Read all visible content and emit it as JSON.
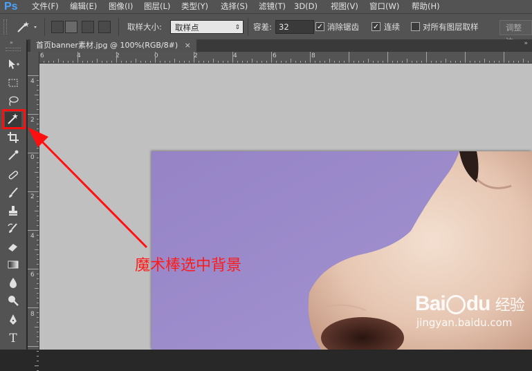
{
  "app": {
    "logo": "Ps"
  },
  "menu": [
    "文件(F)",
    "编辑(E)",
    "图像(I)",
    "图层(L)",
    "类型(Y)",
    "选择(S)",
    "滤镜(T)",
    "3D(D)",
    "视图(V)",
    "窗口(W)",
    "帮助(H)"
  ],
  "options": {
    "sample_size_label": "取样大小:",
    "sample_size_value": "取样点",
    "tolerance_label": "容差:",
    "tolerance_value": "32",
    "anti_alias_label": "消除锯齿",
    "anti_alias_checked": true,
    "contiguous_label": "连续",
    "contiguous_checked": true,
    "all_layers_label": "对所有图层取样",
    "all_layers_checked": false,
    "refine_edge_label": "调整边"
  },
  "document": {
    "tab_title": "首页banner素材.jpg @ 100%(RGB/8#)",
    "close_glyph": "×"
  },
  "rulers": {
    "top_labels": [
      "6",
      "4",
      "2",
      "0",
      "2",
      "4",
      "6",
      "8"
    ],
    "left_labels": [
      "4",
      "2",
      "0",
      "2",
      "4",
      "6",
      "8"
    ]
  },
  "annotation": {
    "text": "魔术棒选中背景",
    "color": "#ff1a1a"
  },
  "watermark": {
    "brand": "Bai",
    "brand_suffix": "du",
    "product": "经验",
    "url": "jingyan.baidu.com"
  },
  "colors": {
    "background_purple": "#9b87c9",
    "annotation_red": "#ff1a1a",
    "logo_blue": "#4aa3ff"
  },
  "tools": [
    "move-icon",
    "marquee-icon",
    "lasso-icon",
    "magic-wand-icon",
    "crop-icon",
    "eyedropper-icon",
    "healing-brush-icon",
    "brush-icon",
    "clone-stamp-icon",
    "history-brush-icon",
    "eraser-icon",
    "gradient-icon",
    "blur-icon",
    "dodge-icon",
    "pen-icon",
    "type-icon"
  ]
}
